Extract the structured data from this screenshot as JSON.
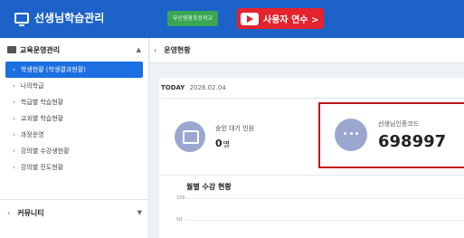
{
  "header": {
    "app_title": "선생님학습관리",
    "school_badge": "부산영광초등학교",
    "training_button": "사용자 연수 >"
  },
  "sidebar": {
    "section_title": "교육운영관리",
    "items": [
      {
        "label": "학생현황 (학생결과현황)",
        "active": true
      },
      {
        "label": "나의학급",
        "active": false
      },
      {
        "label": "학급별 학습현황",
        "active": false
      },
      {
        "label": "교과별 학습현황",
        "active": false
      },
      {
        "label": "과정운영",
        "active": false
      },
      {
        "label": "강의별 수강생현황",
        "active": false
      },
      {
        "label": "강의별 진도현황",
        "active": false
      }
    ],
    "community_label": "커뮤니티"
  },
  "breadcrumb": {
    "current": "운영현황"
  },
  "today": {
    "label": "TODAY",
    "date": "2026.02.04"
  },
  "stats": {
    "approval_label": "승인 대기 인원",
    "approval_value": "0",
    "approval_unit": "명",
    "code_label": "선생님인증코드",
    "code_value": "698997"
  },
  "chart": {
    "title": "월별 수강 현황",
    "ticks": [
      "100",
      "50"
    ]
  },
  "colors": {
    "header_bg": "#1c62c9",
    "active_item": "#1c6fe0",
    "school_badge": "#3aa655",
    "training_button": "#e4232d",
    "highlight_border": "#c3161c"
  }
}
